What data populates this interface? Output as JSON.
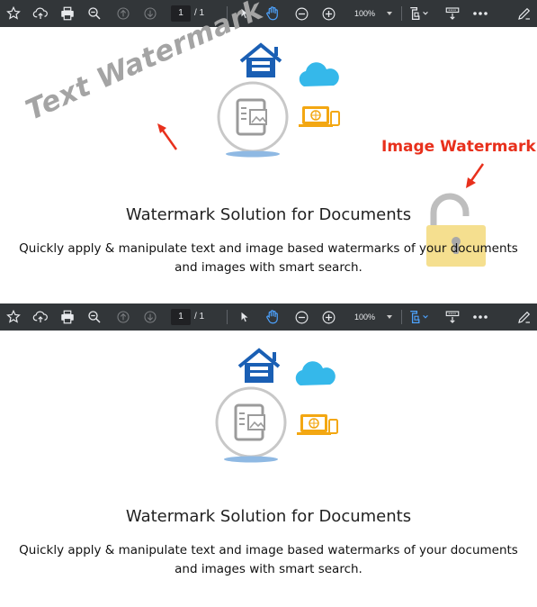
{
  "toolbar": {
    "page_current": "1",
    "page_total": "/ 1",
    "zoom_level": "100%",
    "icons": [
      "star-icon",
      "upload-icon",
      "print-icon",
      "zoom-search-icon",
      "arrow-up-icon",
      "arrow-down-icon",
      "cursor-icon",
      "hand-icon",
      "zoom-out-icon",
      "zoom-in-icon",
      "fit-page-icon",
      "stamp-icon",
      "more-icon",
      "sign-icon"
    ],
    "accent_color": "#4da3ff",
    "background_color": "#323639"
  },
  "document": {
    "title": "Watermark Solution for Documents",
    "description_line1": "Quickly apply & manipulate text and image based watermarks of your documents",
    "description_line2": "and images with smart search."
  },
  "watermarks": {
    "text_watermark": "Text Watermark",
    "image_watermark_label": "Image Watermark",
    "label_color": "#e8301c",
    "text_color": "#a4a4a4",
    "image_watermark_icon": "padlock-icon"
  },
  "illustration": {
    "icons": [
      "house-server-icon",
      "cloud-icon",
      "document-icon",
      "laptop-globe-icon"
    ]
  }
}
